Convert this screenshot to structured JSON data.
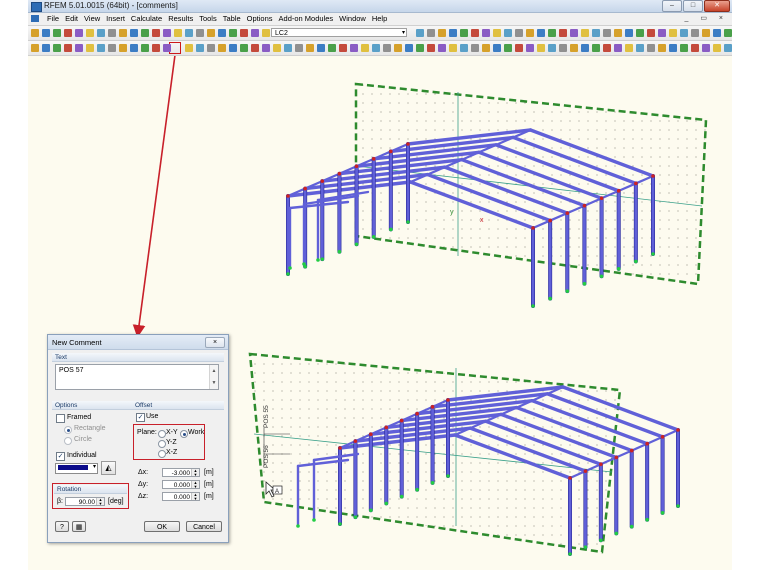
{
  "window": {
    "title": "RFEM 5.01.0015 (64bit) - [comments]"
  },
  "menubar": {
    "items": [
      "File",
      "Edit",
      "View",
      "Insert",
      "Calculate",
      "Results",
      "Tools",
      "Table",
      "Options",
      "Add-on Modules",
      "Window",
      "Help"
    ],
    "right": "_ ▭ ×"
  },
  "toolbar": {
    "loadcase": "LC2"
  },
  "colors": {
    "frame": "#6060d8",
    "frame_outline": "#2a2a9a",
    "plane": "#2e8b2e",
    "annotation": "#c8202a",
    "cursor": "#333333"
  },
  "canvas": {
    "label_a": "POS 55",
    "label_b": "POS 56"
  },
  "dialog": {
    "title": "New Comment",
    "close": "×",
    "text_section": "Text",
    "text_value": "POS 57",
    "options_section": "Options",
    "framed_label": "Framed",
    "rectangle_label": "Rectangle",
    "circle_label": "Circle",
    "individual_label": "Individual",
    "offset_section": "Offset",
    "use_label": "Use",
    "plane_label": "Plane:",
    "xy_label": "X-Y",
    "work_label": "Work",
    "yz_label": "Y-Z",
    "xz_label": "X-Z",
    "dx_label": "Δx:",
    "dy_label": "Δy:",
    "dz_label": "Δz:",
    "dx_value": "-3.000",
    "dy_value": "0.000",
    "dz_value": "0.000",
    "unit_m": "[m]",
    "rotation_section": "Rotation",
    "beta_label": "β:",
    "beta_value": "90.00",
    "unit_deg": "[deg]",
    "ok": "OK",
    "cancel": "Cancel"
  }
}
